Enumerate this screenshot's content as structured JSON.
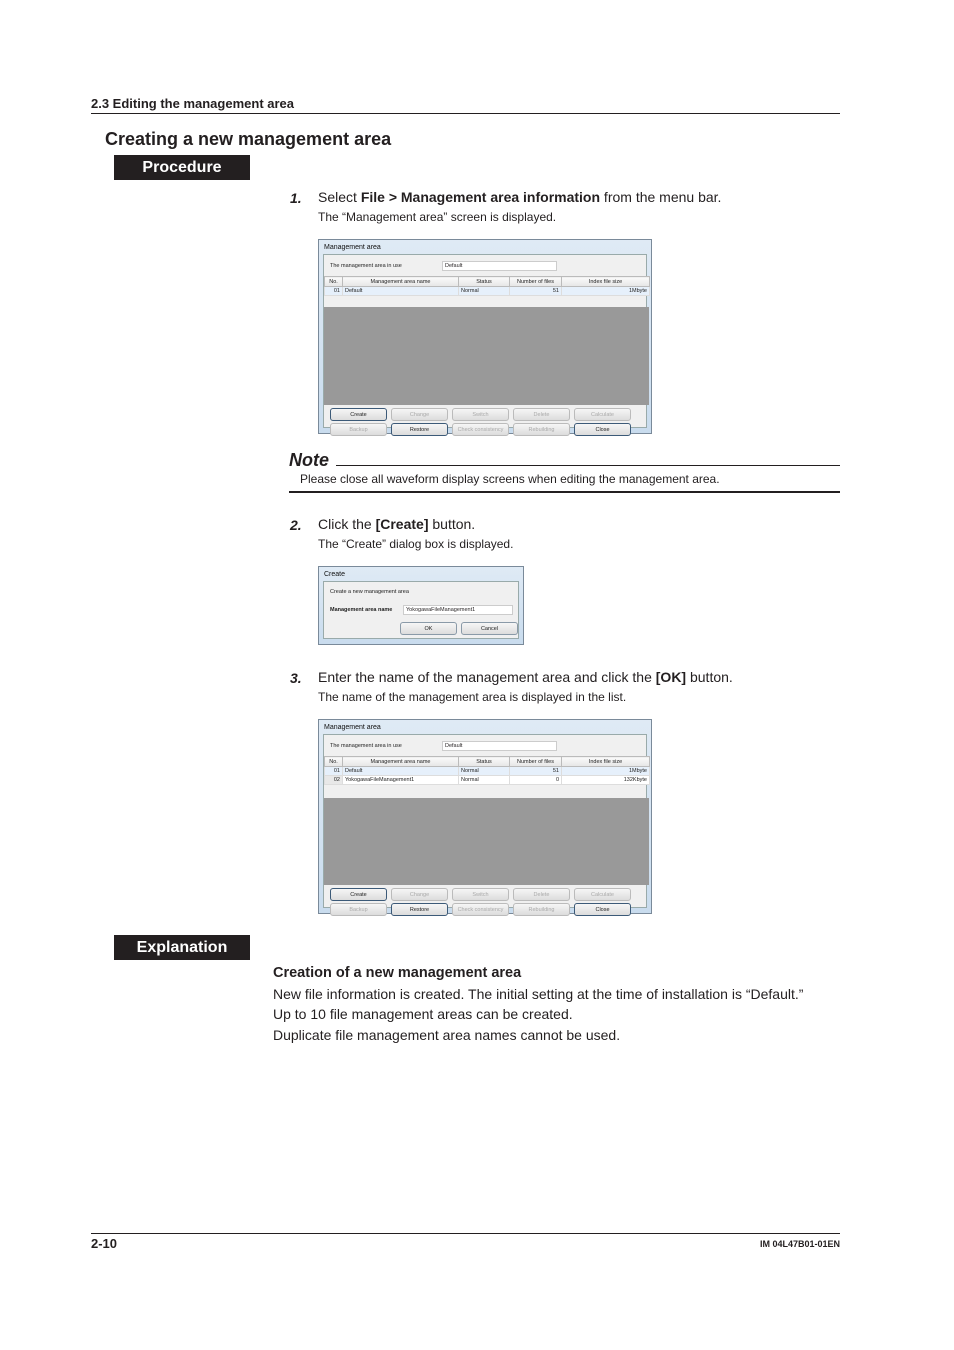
{
  "header": {
    "section": "2.3  Editing the management area",
    "title": "Creating a new management area"
  },
  "labels": {
    "procedure": "Procedure",
    "explanation": "Explanation"
  },
  "steps": [
    {
      "num": "1.",
      "pre": "Select ",
      "bold": "File > Management area information",
      "post": " from the menu bar.",
      "sub": "The “Management area” screen is displayed."
    },
    {
      "num": "2.",
      "pre": "Click the ",
      "bold": "[Create]",
      "post": " button.",
      "sub": "The “Create” dialog box is displayed."
    },
    {
      "num": "3.",
      "pre": "Enter the name of the management area and click the ",
      "bold": "[OK]",
      "post": " button.",
      "sub": "The name of the management area is displayed in the list."
    }
  ],
  "note": {
    "title": "Note",
    "text": "Please close all waveform display screens when editing the management area."
  },
  "mgmt_window_1": {
    "title": "Management area",
    "in_use_label": "The management area in use",
    "in_use_value": "Default",
    "columns": [
      "No.",
      "Management area name",
      "Status",
      "Number of files",
      "Index file size"
    ],
    "rows": [
      [
        "01",
        "Default",
        "Normal",
        "51",
        "1Mbyte"
      ]
    ]
  },
  "mgmt_window_2": {
    "title": "Management area",
    "in_use_label": "The management area in use",
    "in_use_value": "Default",
    "columns": [
      "No.",
      "Management area name",
      "Status",
      "Number of files",
      "Index file size"
    ],
    "rows": [
      [
        "01",
        "Default",
        "Normal",
        "51",
        "1Mbyte"
      ],
      [
        "02",
        "YokogawaFileManagement1",
        "Normal",
        "0",
        "132Kbyte"
      ]
    ]
  },
  "buttons": {
    "row1": [
      "Create",
      "Change",
      "Switch",
      "Delete",
      "Calculate"
    ],
    "row2": [
      "Backup",
      "Restore",
      "Check consistency",
      "Rebuilding",
      "Close"
    ]
  },
  "create_dialog": {
    "title": "Create",
    "heading": "Create a new management area",
    "name_label": "Management area name",
    "name_value": "YokogawaFileManagement1",
    "ok": "OK",
    "cancel": "Cancel"
  },
  "explanation": {
    "heading": "Creation of a new management area",
    "lines": [
      "New file information is created. The initial setting at the time of installation is “Default.”",
      "Up to 10 file management areas can be created.",
      "Duplicate file management area names cannot be used."
    ]
  },
  "footer": {
    "page": "2-10",
    "doc_id": "IM 04L47B01-01EN"
  }
}
